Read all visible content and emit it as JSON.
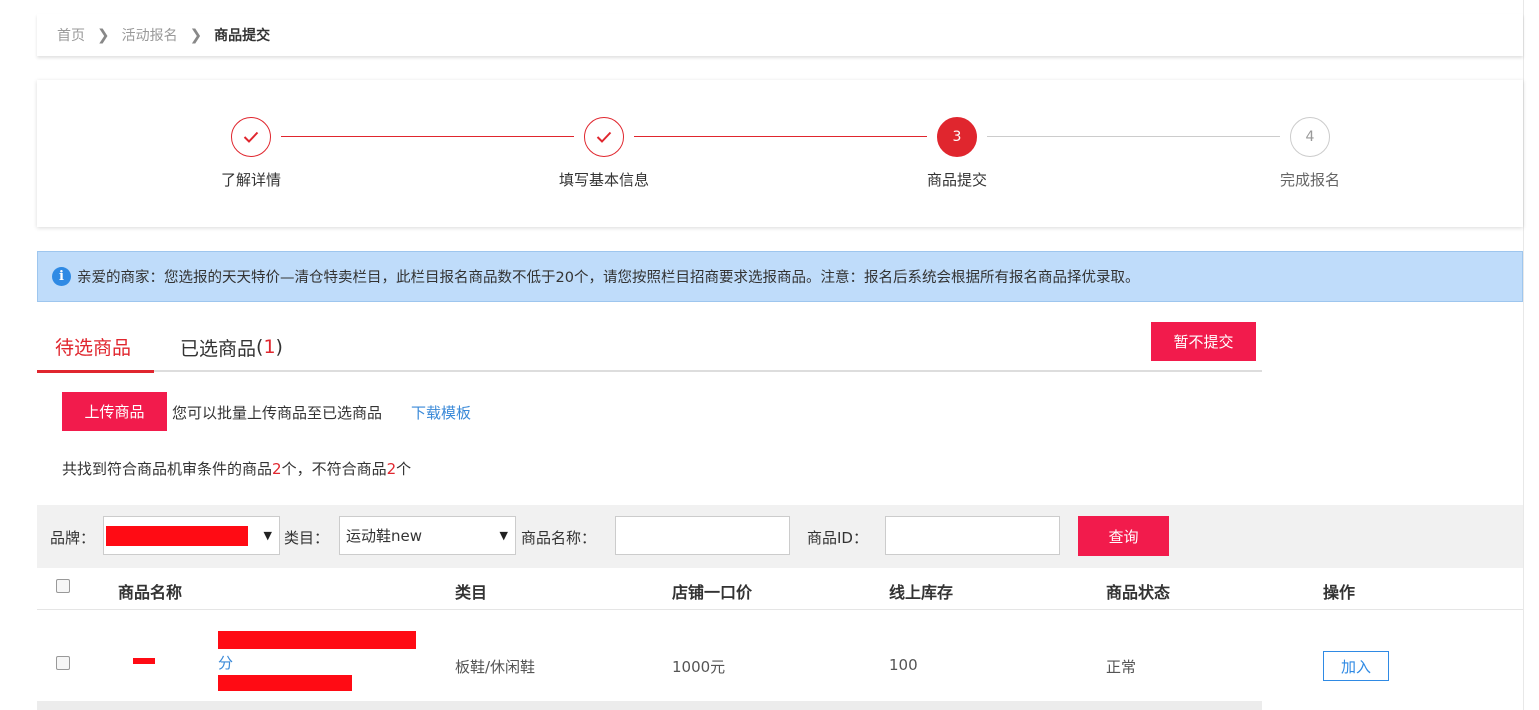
{
  "breadcrumb": {
    "home": "首页",
    "activity": "活动报名",
    "current": "商品提交"
  },
  "steps": [
    {
      "label": "了解详情",
      "state": "done",
      "number": "1"
    },
    {
      "label": "填写基本信息",
      "state": "done",
      "number": "2"
    },
    {
      "label": "商品提交",
      "state": "current",
      "number": "3"
    },
    {
      "label": "完成报名",
      "state": "todo",
      "number": "4"
    }
  ],
  "notice": {
    "icon": "info-icon",
    "text": "亲爱的商家：您选报的天天特价—清仓特卖栏目，此栏目报名商品数不低于20个，请您按照栏目招商要求选报商品。注意：报名后系统会根据所有报名商品择优录取。"
  },
  "tabs": {
    "pending_label": "待选商品",
    "selected_label": "已选商品",
    "selected_count_open": "(",
    "selected_count": "1",
    "selected_count_close": ")"
  },
  "actions": {
    "hold_label": "暂不提交",
    "upload_label": "上传商品",
    "upload_hint": "您可以批量上传商品至已选商品",
    "download_label": "下载模板"
  },
  "result": {
    "prefix": "共找到符合商品机审条件的商品",
    "match_count": "2",
    "middle": "个，不符合商品",
    "mismatch_count": "2",
    "suffix": "个"
  },
  "filters": {
    "brand_label": "品牌：",
    "category_label": "类目：",
    "category_value": "运动鞋new",
    "name_label": "商品名称：",
    "id_label": "商品ID：",
    "query_label": "查询"
  },
  "table": {
    "headers": {
      "name": "商品名称",
      "category": "类目",
      "price": "店铺一口价",
      "stock": "线上库存",
      "status": "商品状态",
      "action": "操作"
    },
    "rows": [
      {
        "name_partial": "分",
        "category": "板鞋/休闲鞋",
        "price": "1000元",
        "stock": "100",
        "status": "正常",
        "action_label": "加入"
      }
    ]
  },
  "colors": {
    "accent": "#e0262e",
    "button_red": "#f21b4c",
    "link_blue": "#3b8ad8",
    "notice_bg": "#bfdcfa"
  }
}
